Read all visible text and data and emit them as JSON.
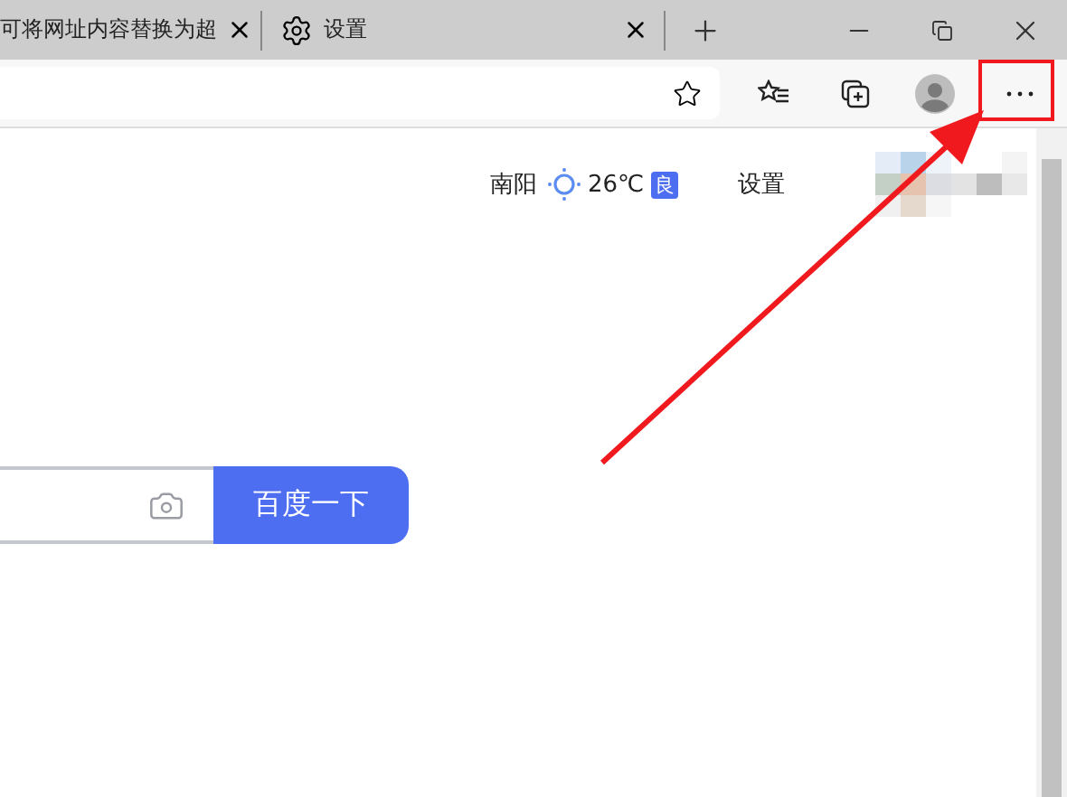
{
  "tabs": [
    {
      "title": "可将网址内容替换为超"
    },
    {
      "title": "设置"
    }
  ],
  "weather": {
    "city": "南阳",
    "temperature": "26℃",
    "air_quality": "良"
  },
  "settings_link": "设置",
  "search": {
    "button": "百度一下"
  }
}
